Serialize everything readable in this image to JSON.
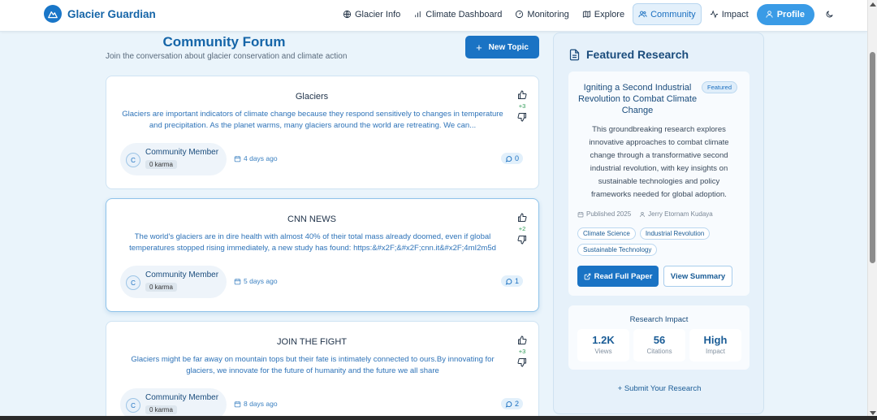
{
  "brand": {
    "name": "Glacier Guardian"
  },
  "nav": {
    "items": [
      {
        "label": "Glacier Info",
        "icon": "globe-icon"
      },
      {
        "label": "Climate Dashboard",
        "icon": "bar-chart-icon"
      },
      {
        "label": "Monitoring",
        "icon": "gauge-icon"
      },
      {
        "label": "Explore",
        "icon": "map-icon"
      },
      {
        "label": "Community",
        "icon": "users-icon",
        "active": true
      },
      {
        "label": "Impact",
        "icon": "activity-icon"
      }
    ],
    "profile_label": "Profile"
  },
  "forum": {
    "title": "Community Forum",
    "subtitle": "Join the conversation about glacier conservation and climate action",
    "new_topic_label": "New Topic",
    "posts": [
      {
        "title": "Glaciers",
        "body": "Glaciers are important indicators of climate change because they respond sensitively to changes in temperature and precipitation. As the planet warms, many glaciers around the world are retreating. We can...",
        "votes": "+3",
        "author": "Community Member",
        "avatar_initial": "C",
        "karma": "0 karma",
        "date": "4 days ago",
        "comments": "0"
      },
      {
        "title": "CNN NEWS",
        "body": "The world's glaciers are in dire health with almost 40% of their total mass already doomed, even if global temperatures stopped rising immediately, a new study has found: https:&#x2F;&#x2F;cnn.it&#x2F;4mI2m5d",
        "votes": "+2",
        "author": "Community Member",
        "avatar_initial": "C",
        "karma": "0 karma",
        "date": "5 days ago",
        "comments": "1"
      },
      {
        "title": "JOIN THE FIGHT",
        "body": "Glaciers might be far away on mountain tops but their fate is intimately connected to ours.By innovating for glaciers, we innovate for the future of humanity and the future we all share",
        "votes": "+3",
        "author": "Community Member",
        "avatar_initial": "C",
        "karma": "0 karma",
        "date": "8 days ago",
        "comments": "2"
      }
    ]
  },
  "sidebar": {
    "title": "Featured Research",
    "paper": {
      "title": "Igniting a Second Industrial Revolution to Combat Climate Change",
      "badge": "Featured",
      "abstract": "This groundbreaking research explores innovative approaches to combat climate change through a transformative second industrial revolution, with key insights on sustainable technologies and policy frameworks needed for global adoption.",
      "published": "Published 2025",
      "author": "Jerry Etornam Kudaya",
      "tags": [
        "Climate Science",
        "Industrial Revolution",
        "Sustainable Technology"
      ],
      "read_label": "Read Full Paper",
      "summary_label": "View Summary"
    },
    "impact": {
      "title": "Research Impact",
      "stats": [
        {
          "value": "1.2K",
          "label": "Views"
        },
        {
          "value": "56",
          "label": "Citations"
        },
        {
          "value": "High",
          "label": "Impact"
        }
      ]
    },
    "submit_label": "Submit Your Research"
  },
  "colors": {
    "accent": "#1a73c4",
    "brand": "#1565a8",
    "vote_positive": "#2e9a56"
  }
}
